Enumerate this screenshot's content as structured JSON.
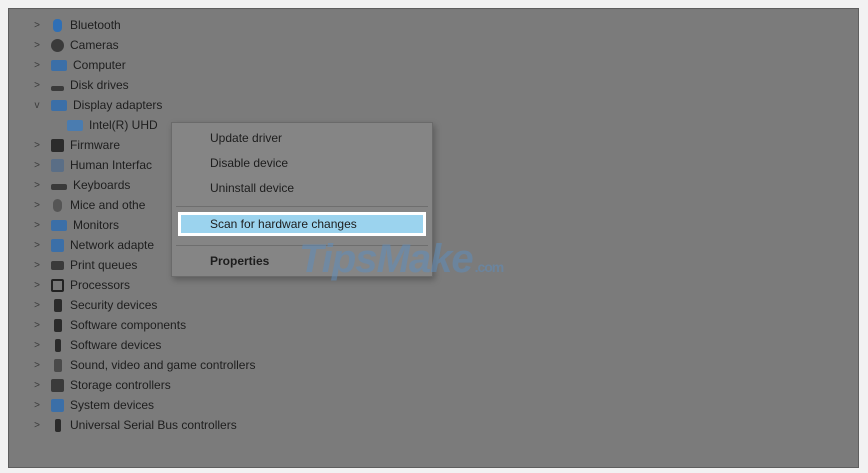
{
  "tree": {
    "items": [
      {
        "label": "Bluetooth",
        "icon": "bluetooth-icon",
        "chevron": ">"
      },
      {
        "label": "Cameras",
        "icon": "camera-icon",
        "chevron": ">"
      },
      {
        "label": "Computer",
        "icon": "computer-icon",
        "chevron": ">"
      },
      {
        "label": "Disk drives",
        "icon": "disk-drive-icon",
        "chevron": ">"
      },
      {
        "label": "Display adapters",
        "icon": "monitor-icon",
        "chevron": "v"
      },
      {
        "label": "Intel(R) UHD",
        "icon": "display-adapter-icon",
        "chevron": ""
      },
      {
        "label": "Firmware",
        "icon": "firmware-icon",
        "chevron": ">"
      },
      {
        "label": "Human Interfac",
        "icon": "hid-icon",
        "chevron": ">"
      },
      {
        "label": "Keyboards",
        "icon": "keyboard-icon",
        "chevron": ">"
      },
      {
        "label": "Mice and othe",
        "icon": "mouse-icon",
        "chevron": ">"
      },
      {
        "label": "Monitors",
        "icon": "monitor-icon",
        "chevron": ">"
      },
      {
        "label": "Network adapte",
        "icon": "network-icon",
        "chevron": ">"
      },
      {
        "label": "Print queues",
        "icon": "printer-icon",
        "chevron": ">"
      },
      {
        "label": "Processors",
        "icon": "processor-icon",
        "chevron": ">"
      },
      {
        "label": "Security devices",
        "icon": "security-icon",
        "chevron": ">"
      },
      {
        "label": "Software components",
        "icon": "software-component-icon",
        "chevron": ">"
      },
      {
        "label": "Software devices",
        "icon": "software-device-icon",
        "chevron": ">"
      },
      {
        "label": "Sound, video and game controllers",
        "icon": "speaker-icon",
        "chevron": ">"
      },
      {
        "label": "Storage controllers",
        "icon": "storage-icon",
        "chevron": ">"
      },
      {
        "label": "System devices",
        "icon": "system-icon",
        "chevron": ">"
      },
      {
        "label": "Universal Serial Bus controllers",
        "icon": "usb-icon",
        "chevron": ">"
      }
    ]
  },
  "context_menu": {
    "update_driver": "Update driver",
    "disable_device": "Disable device",
    "uninstall_device": "Uninstall device",
    "scan": "Scan for hardware changes",
    "properties": "Properties"
  },
  "watermark": {
    "main": "TipsMake",
    "suffix": ".com"
  },
  "colors": {
    "highlight": "#9bd3ee",
    "background": "#7b7b7b",
    "accent_icon": "#2f6fb5"
  }
}
